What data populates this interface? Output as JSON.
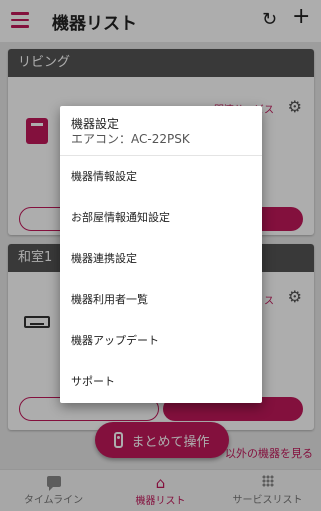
{
  "app": {
    "title": "機器リスト",
    "refresh_icon": "↻",
    "add_icon": "+"
  },
  "rooms": [
    {
      "name": "リビング",
      "related_link": "関連サービス"
    },
    {
      "name": "和室1",
      "related_link": "ス"
    }
  ],
  "fab": {
    "label": "まとめて操作"
  },
  "other_devices_link": "以外の機器を見る",
  "bottom_nav": {
    "items": [
      {
        "label": "タイムライン",
        "icon": "chat-icon"
      },
      {
        "label": "機器リスト",
        "icon": "home-icon"
      },
      {
        "label": "サービスリスト",
        "icon": "grid-icon"
      }
    ]
  },
  "popup": {
    "title": "機器設定",
    "subtitle": "エアコン：AC-22PSK",
    "items": [
      "機器情報設定",
      "お部屋情報通知設定",
      "機器連携設定",
      "機器利用者一覧",
      "機器アップデート",
      "サポート"
    ]
  },
  "colors": {
    "accent": "#c2185b",
    "room_header": "#555555",
    "scrim": "rgba(0,0,0,0.32)"
  }
}
